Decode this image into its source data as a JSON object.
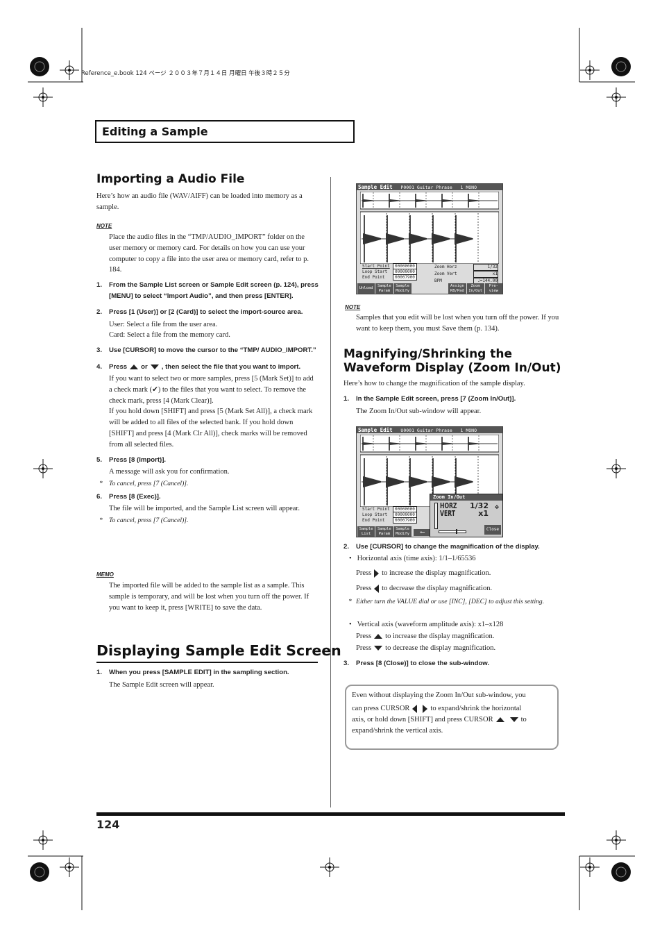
{
  "print_header": "Reference_e.book  124 ページ  ２００３年７月１４日  月曜日  午後３時２５分",
  "section_header": "Editing a Sample",
  "page_number": "124",
  "left": {
    "importing": {
      "title": "Importing a Audio File",
      "intro": "Here’s how an audio file (WAV/AIFF) can be loaded into memory as a sample.",
      "note_badge": "NOTE",
      "note": "Place the audio files in the “TMP/AUDIO_IMPORT” folder on the user memory or memory card. For details on how you can use your computer to copy a file into the user area or memory card, refer to p. 184.",
      "steps": [
        {
          "n": "1.",
          "text": "From the Sample List screen or Sample Edit screen (p. 124), press [MENU] to select “Import Audio”, and then press [ENTER]."
        },
        {
          "n": "2.",
          "text": "Press [1 (User)] or [2 (Card)] to select the import-source area.",
          "body": [
            "User: Select a file from the user area.",
            "Card: Select a file from the memory card."
          ]
        },
        {
          "n": "3.",
          "text": "Use [CURSOR] to move the cursor to the “TMP/ AUDIO_IMPORT.”"
        },
        {
          "n": "4.",
          "pre": "Press",
          "mid": "or",
          "post": ", then select the file that you want to import.",
          "body": [
            "If you want to select two or more samples, press [5 (Mark Set)] to add a check mark (✔) to the files that you want to select. To remove the check mark, press [4 (Mark Clear)].",
            "If you hold down [SHIFT] and press [5 (Mark Set All)], a check mark will be added to all files of the selected bank. If you hold down [SHIFT] and press [4 (Mark Clr All)], check marks will be removed from all selected files."
          ]
        },
        {
          "n": "5.",
          "text": "Press [8 (Import)].",
          "body": [
            "A message will ask you for confirmation."
          ],
          "note": "To cancel, press [7 (Cancel)]."
        },
        {
          "n": "6.",
          "text": "Press [8 (Exec)].",
          "body": [
            "The file will be imported, and the Sample List screen will appear."
          ],
          "note": "To cancel, press [7 (Cancel)]."
        }
      ],
      "memo_badge": "MEMO",
      "memo": "The imported file will be added to the sample list as a sample. This sample is temporary, and will be lost when you turn off the power. If you want to keep it, press [WRITE] to save the data."
    },
    "displaying": {
      "title": "Displaying Sample Edit Screen",
      "step_n": "1.",
      "step": "When you press [SAMPLE EDIT] in the sampling section.",
      "body": "The Sample Edit screen will appear."
    }
  },
  "right": {
    "screen1": {
      "title": "Sample Edit",
      "info": "P0001 Guitar Phrase   1 MONO",
      "marker_s": "S",
      "marker_l": "L",
      "marker_e": "E",
      "params": [
        {
          "label": "Start Point",
          "value": "00000000"
        },
        {
          "label": "Loop Start",
          "value": "00000000"
        },
        {
          "label": "End Point",
          "value": "00007900"
        }
      ],
      "params2": [
        {
          "label": "Zoom Horz",
          "value": "1/32"
        },
        {
          "label": "Zoom Vert",
          "value": "x1"
        },
        {
          "label": "BPM",
          "value": "♩=144.00"
        }
      ],
      "fkeys": [
        "Unload",
        "Sample Param",
        "Sample Modify",
        "",
        "",
        "Assign KB/Pad",
        "Zoom In/Out",
        "Pre-view"
      ]
    },
    "note_badge": "NOTE",
    "note": "Samples that you edit will be lost when you turn off the power. If you want to keep them, you must Save them (p. 134).",
    "zoom": {
      "title": "Magnifying/Shrinking the Waveform Display (Zoom In/Out)",
      "intro": "Here’s how to change the magnification of the sample display.",
      "step1_n": "1.",
      "step1": "In the Sample Edit screen, press [7 (Zoom In/Out)].",
      "step1_body": "The Zoom In/Out sub-window will appear.",
      "screen2": {
        "title": "Sample Edit",
        "info": "U0001 Guitar Phrase   1 MONO",
        "params": [
          {
            "label": "Start Point",
            "value": "00000000"
          },
          {
            "label": "Loop Start",
            "value": "00000000"
          },
          {
            "label": "End Point",
            "value": "00007900"
          }
        ],
        "fkeys": [
          "Sample List",
          "Sample Param",
          "Sample Modify"
        ],
        "popup": {
          "title": "Zoom In/Out",
          "horz": "HORZ",
          "vert": "VERT",
          "horz_value": "1/32",
          "vert_value": "x1",
          "close": "Close"
        }
      },
      "step2_n": "2.",
      "step2": "Use [CURSOR] to change the magnification of the display.",
      "horizontal": "Horizontal axis (time axis): 1/1–1/65536",
      "press": "Press",
      "increase": "to increase the display magnification.",
      "decrease": "to decrease the display magnification.",
      "tip": "Either turn the VALUE dial or use [INC], [DEC] to adjust this setting.",
      "vertical": "Vertical axis (waveform amplitude axis): x1–x128",
      "step3_n": "3.",
      "step3": "Press [8 (Close)] to close the sub-window.",
      "box": {
        "line1": "Even without displaying the Zoom In/Out sub-window, you",
        "line2a": "can press CURSOR",
        "line2b": "to expand/shrink the horizontal",
        "line3a": "axis, or hold down [SHIFT] and press CURSOR",
        "line3b": "to",
        "line4": "expand/shrink the vertical axis."
      }
    }
  }
}
